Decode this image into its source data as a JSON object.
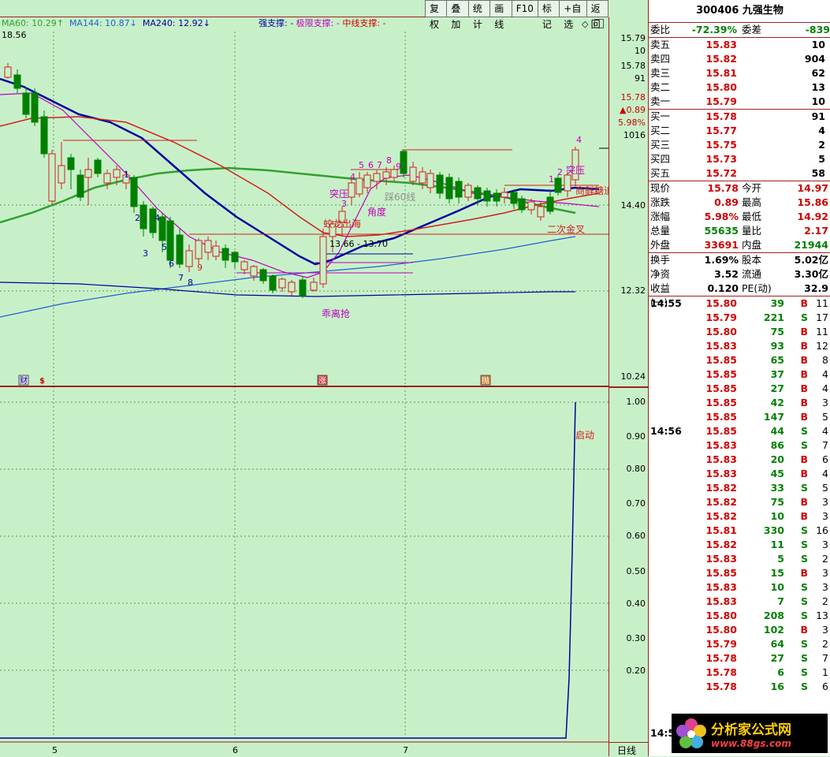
{
  "toolbar": [
    "复权",
    "叠加",
    "统计",
    "画线",
    "F10",
    "标记",
    "+自选",
    "返回"
  ],
  "ma_legend": {
    "ma60": "MA60: 10.29↑",
    "ma144": "MA144: 10.87↓",
    "ma240": "MA240: 12.92↓",
    "high_label": "18.56"
  },
  "support": {
    "strong": "强支撑: -",
    "limit": "极限支撑: -",
    "mid": "中线支撑: -"
  },
  "colors": {
    "bg": "#c8f0c8",
    "up": "#d00000",
    "down": "#008000",
    "ma_blue": "#0000a0",
    "ma_red": "#d02020",
    "ma_green": "#30a030",
    "ma_magenta": "#c000c0"
  },
  "price_axis": {
    "upper": [
      "15.79",
      "10",
      "15.78",
      "91",
      "15.78",
      "▲0.89",
      "5.98%",
      "1016",
      "14.40",
      "12.32",
      "10.24"
    ],
    "lower": [
      "1.00",
      "0.90",
      "0.80",
      "0.70",
      "0.60",
      "0.50",
      "0.40",
      "0.30",
      "0.20"
    ]
  },
  "date_axis": [
    "5",
    "6",
    "7"
  ],
  "period_label": "日线",
  "chart_annotations": {
    "tupo1": "突压",
    "tupo2": "突压",
    "jiaodu": "角度",
    "cai60": "踩60线",
    "jiaolong": "蛟龙出海",
    "range": "13.66 - 13.70",
    "guaili": "乖离抢",
    "erci": "二次金叉",
    "qidong": "启动",
    "shangtuo": "商鲜糖追",
    "cai": "财",
    "zhang": "涨",
    "gou": "抛"
  },
  "quote": {
    "code_name": "300406 九强生物",
    "weibi_label": "委比",
    "weibi": "-72.39%",
    "weicha_label": "委差",
    "weicha": "-839",
    "asks": [
      {
        "l": "卖五",
        "p": "15.83",
        "v": "10"
      },
      {
        "l": "卖四",
        "p": "15.82",
        "v": "904"
      },
      {
        "l": "卖三",
        "p": "15.81",
        "v": "62"
      },
      {
        "l": "卖二",
        "p": "15.80",
        "v": "13"
      },
      {
        "l": "卖一",
        "p": "15.79",
        "v": "10"
      }
    ],
    "bids": [
      {
        "l": "买一",
        "p": "15.78",
        "v": "91"
      },
      {
        "l": "买二",
        "p": "15.77",
        "v": "4"
      },
      {
        "l": "买三",
        "p": "15.75",
        "v": "2"
      },
      {
        "l": "买四",
        "p": "15.73",
        "v": "5"
      },
      {
        "l": "买五",
        "p": "15.72",
        "v": "58"
      }
    ],
    "stats": [
      {
        "l1": "现价",
        "v1": "15.78",
        "c1": "red",
        "l2": "今开",
        "v2": "14.97",
        "c2": "red"
      },
      {
        "l1": "涨跌",
        "v1": "0.89",
        "c1": "red",
        "l2": "最高",
        "v2": "15.86",
        "c2": "red"
      },
      {
        "l1": "涨幅",
        "v1": "5.98%",
        "c1": "red",
        "l2": "最低",
        "v2": "14.92",
        "c2": "red"
      },
      {
        "l1": "总量",
        "v1": "55635",
        "c1": "green",
        "l2": "量比",
        "v2": "2.17",
        "c2": "red"
      },
      {
        "l1": "外盘",
        "v1": "33691",
        "c1": "red",
        "l2": "内盘",
        "v2": "21944",
        "c2": "green"
      }
    ],
    "stats2": [
      {
        "l1": "换手",
        "v1": "1.69%",
        "l2": "股本",
        "v2": "5.02亿"
      },
      {
        "l1": "净资",
        "v1": "3.52",
        "l2": "流通",
        "v2": "3.30亿"
      },
      {
        "l1": "收益(一)",
        "v1": "0.120",
        "l2": "PE(动)",
        "v2": "32.9"
      }
    ],
    "ticks": [
      {
        "t": "14:55",
        "p": "15.80",
        "v": "39",
        "bs": "B",
        "n": "11"
      },
      {
        "t": "",
        "p": "15.79",
        "v": "221",
        "bs": "S",
        "n": "17"
      },
      {
        "t": "",
        "p": "15.80",
        "v": "75",
        "bs": "B",
        "n": "11"
      },
      {
        "t": "",
        "p": "15.83",
        "v": "93",
        "bs": "B",
        "n": "12"
      },
      {
        "t": "",
        "p": "15.85",
        "v": "65",
        "bs": "B",
        "n": "8"
      },
      {
        "t": "",
        "p": "15.85",
        "v": "37",
        "bs": "B",
        "n": "4"
      },
      {
        "t": "",
        "p": "15.85",
        "v": "27",
        "bs": "B",
        "n": "4"
      },
      {
        "t": "",
        "p": "15.85",
        "v": "42",
        "bs": "B",
        "n": "3"
      },
      {
        "t": "",
        "p": "15.85",
        "v": "147",
        "bs": "B",
        "n": "5"
      },
      {
        "t": "14:56",
        "p": "15.85",
        "v": "44",
        "bs": "S",
        "n": "4"
      },
      {
        "t": "",
        "p": "15.83",
        "v": "86",
        "bs": "S",
        "n": "7"
      },
      {
        "t": "",
        "p": "15.83",
        "v": "20",
        "bs": "B",
        "n": "6"
      },
      {
        "t": "",
        "p": "15.83",
        "v": "45",
        "bs": "B",
        "n": "4"
      },
      {
        "t": "",
        "p": "15.82",
        "v": "33",
        "bs": "S",
        "n": "5"
      },
      {
        "t": "",
        "p": "15.82",
        "v": "75",
        "bs": "B",
        "n": "3"
      },
      {
        "t": "",
        "p": "15.82",
        "v": "10",
        "bs": "B",
        "n": "3"
      },
      {
        "t": "",
        "p": "15.81",
        "v": "330",
        "bs": "S",
        "n": "16"
      },
      {
        "t": "",
        "p": "15.82",
        "v": "11",
        "bs": "S",
        "n": "3"
      },
      {
        "t": "",
        "p": "15.83",
        "v": "5",
        "bs": "S",
        "n": "2"
      },
      {
        "t": "",
        "p": "15.85",
        "v": "15",
        "bs": "B",
        "n": "3"
      },
      {
        "t": "",
        "p": "15.83",
        "v": "10",
        "bs": "S",
        "n": "3"
      },
      {
        "t": "",
        "p": "15.83",
        "v": "7",
        "bs": "S",
        "n": "2"
      },
      {
        "t": "",
        "p": "15.80",
        "v": "208",
        "bs": "S",
        "n": "13"
      },
      {
        "t": "",
        "p": "15.80",
        "v": "102",
        "bs": "B",
        "n": "3"
      },
      {
        "t": "",
        "p": "15.79",
        "v": "64",
        "bs": "S",
        "n": "2"
      },
      {
        "t": "",
        "p": "15.78",
        "v": "27",
        "bs": "S",
        "n": "7"
      },
      {
        "t": "",
        "p": "15.78",
        "v": "6",
        "bs": "S",
        "n": "1"
      },
      {
        "t": "",
        "p": "15.78",
        "v": "16",
        "bs": "S",
        "n": "6"
      }
    ],
    "last_time": "14:5"
  },
  "watermark": {
    "text": "分析家公式网",
    "url": "www.88gs.com"
  }
}
